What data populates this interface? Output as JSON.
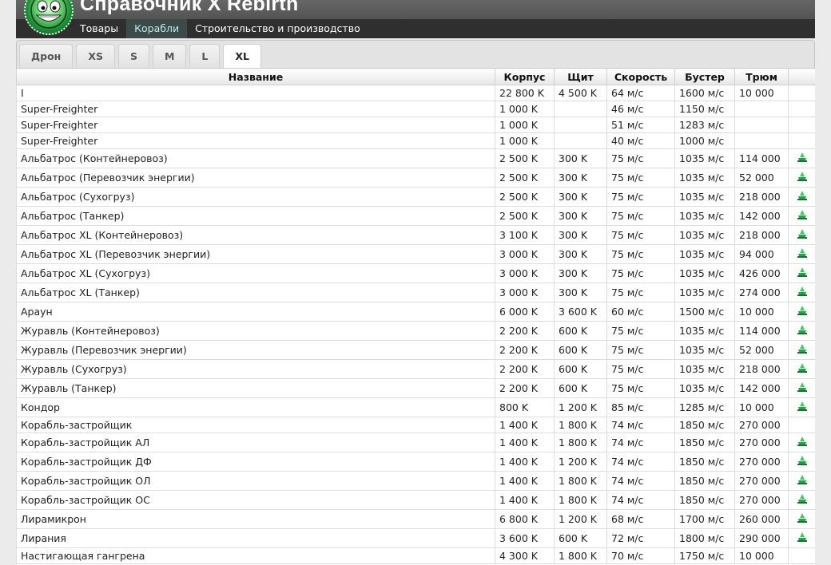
{
  "site": {
    "title": "Справочник X Rebirth",
    "nav": [
      "Товары",
      "Корабли",
      "Строительство и производство"
    ],
    "active_nav": 1
  },
  "tabs": [
    "Дрон",
    "XS",
    "S",
    "M",
    "L",
    "XL"
  ],
  "active_tab": 5,
  "table": {
    "columns": [
      "Название",
      "Корпус",
      "Щит",
      "Скорость",
      "Бустер",
      "Трюм",
      ""
    ],
    "rows": [
      {
        "name": "I",
        "hull": "22 800 K",
        "shield": "4 500 K",
        "speed": "64 м/с",
        "boost": "1600 м/с",
        "cargo": "10 000",
        "icon": false
      },
      {
        "name": "Super-Freighter",
        "hull": "1 000 K",
        "shield": "",
        "speed": "46 м/с",
        "boost": "1150 м/с",
        "cargo": "",
        "icon": false
      },
      {
        "name": "Super-Freighter",
        "hull": "1 000 K",
        "shield": "",
        "speed": "51 м/с",
        "boost": "1283 м/с",
        "cargo": "",
        "icon": false
      },
      {
        "name": "Super-Freighter",
        "hull": "1 000 K",
        "shield": "",
        "speed": "40 м/с",
        "boost": "1000 м/с",
        "cargo": "",
        "icon": false
      },
      {
        "name": "Альбатрос (Контейнеровоз)",
        "hull": "2 500 K",
        "shield": "300 K",
        "speed": "75 м/с",
        "boost": "1035 м/с",
        "cargo": "114 000",
        "icon": true
      },
      {
        "name": "Альбатрос (Перевозчик энергии)",
        "hull": "2 500 K",
        "shield": "300 K",
        "speed": "75 м/с",
        "boost": "1035 м/с",
        "cargo": "52 000",
        "icon": true
      },
      {
        "name": "Альбатрос (Сухогруз)",
        "hull": "2 500 K",
        "shield": "300 K",
        "speed": "75 м/с",
        "boost": "1035 м/с",
        "cargo": "218 000",
        "icon": true
      },
      {
        "name": "Альбатрос (Танкер)",
        "hull": "2 500 K",
        "shield": "300 K",
        "speed": "75 м/с",
        "boost": "1035 м/с",
        "cargo": "142 000",
        "icon": true
      },
      {
        "name": "Альбатрос XL (Контейнеровоз)",
        "hull": "3 100 K",
        "shield": "300 K",
        "speed": "75 м/с",
        "boost": "1035 м/с",
        "cargo": "218 000",
        "icon": true
      },
      {
        "name": "Альбатрос XL (Перевозчик энергии)",
        "hull": "3 000 K",
        "shield": "300 K",
        "speed": "75 м/с",
        "boost": "1035 м/с",
        "cargo": "94 000",
        "icon": true
      },
      {
        "name": "Альбатрос XL (Сухогруз)",
        "hull": "3 000 K",
        "shield": "300 K",
        "speed": "75 м/с",
        "boost": "1035 м/с",
        "cargo": "426 000",
        "icon": true
      },
      {
        "name": "Альбатрос XL (Танкер)",
        "hull": "3 000 K",
        "shield": "300 K",
        "speed": "75 м/с",
        "boost": "1035 м/с",
        "cargo": "274 000",
        "icon": true
      },
      {
        "name": "Араун",
        "hull": "6 000 K",
        "shield": "3 600 K",
        "speed": "60 м/с",
        "boost": "1500 м/с",
        "cargo": "10 000",
        "icon": true
      },
      {
        "name": "Журавль (Контейнеровоз)",
        "hull": "2 200 K",
        "shield": "600 K",
        "speed": "75 м/с",
        "boost": "1035 м/с",
        "cargo": "114 000",
        "icon": true
      },
      {
        "name": "Журавль (Перевозчик энергии)",
        "hull": "2 200 K",
        "shield": "600 K",
        "speed": "75 м/с",
        "boost": "1035 м/с",
        "cargo": "52 000",
        "icon": true
      },
      {
        "name": "Журавль (Сухогруз)",
        "hull": "2 200 K",
        "shield": "600 K",
        "speed": "75 м/с",
        "boost": "1035 м/с",
        "cargo": "218 000",
        "icon": true
      },
      {
        "name": "Журавль (Танкер)",
        "hull": "2 200 K",
        "shield": "600 K",
        "speed": "75 м/с",
        "boost": "1035 м/с",
        "cargo": "142 000",
        "icon": true
      },
      {
        "name": "Кондор",
        "hull": "800 K",
        "shield": "1 200 K",
        "speed": "85 м/с",
        "boost": "1285 м/с",
        "cargo": "10 000",
        "icon": true
      },
      {
        "name": "Корабль-застройщик",
        "hull": "1 400 K",
        "shield": "1 800 K",
        "speed": "74 м/с",
        "boost": "1850 м/с",
        "cargo": "270 000",
        "icon": false
      },
      {
        "name": "Корабль-застройщик АЛ",
        "hull": "1 400 K",
        "shield": "1 800 K",
        "speed": "74 м/с",
        "boost": "1850 м/с",
        "cargo": "270 000",
        "icon": true
      },
      {
        "name": "Корабль-застройщик ДФ",
        "hull": "1 400 K",
        "shield": "1 200 K",
        "speed": "74 м/с",
        "boost": "1850 м/с",
        "cargo": "270 000",
        "icon": true
      },
      {
        "name": "Корабль-застройщик ОЛ",
        "hull": "1 400 K",
        "shield": "1 800 K",
        "speed": "74 м/с",
        "boost": "1850 м/с",
        "cargo": "270 000",
        "icon": true
      },
      {
        "name": "Корабль-застройщик ОС",
        "hull": "1 400 K",
        "shield": "1 800 K",
        "speed": "74 м/с",
        "boost": "1850 м/с",
        "cargo": "270 000",
        "icon": true
      },
      {
        "name": "Лирамикрон",
        "hull": "6 800 K",
        "shield": "1 200 K",
        "speed": "68 м/с",
        "boost": "1700 м/с",
        "cargo": "260 000",
        "icon": true
      },
      {
        "name": "Лирания",
        "hull": "3 600 K",
        "shield": "600 K",
        "speed": "72 м/с",
        "boost": "1800 м/с",
        "cargo": "290 000",
        "icon": true
      },
      {
        "name": "Настигающая гангрена",
        "hull": "4 300 K",
        "shield": "1 800 K",
        "speed": "70 м/с",
        "boost": "1750 м/с",
        "cargo": "10 000",
        "icon": false
      }
    ]
  },
  "colors": {
    "header_bg": "#2f2f2f",
    "title_band": "#5a5a5a",
    "active_nav_bg": "#3c4b49",
    "active_nav_text": "#bfe9ee",
    "icon_green": "#2e9e4a"
  },
  "icons": {
    "ship": "ship-model-icon",
    "logo": "grinning-logo-icon"
  }
}
